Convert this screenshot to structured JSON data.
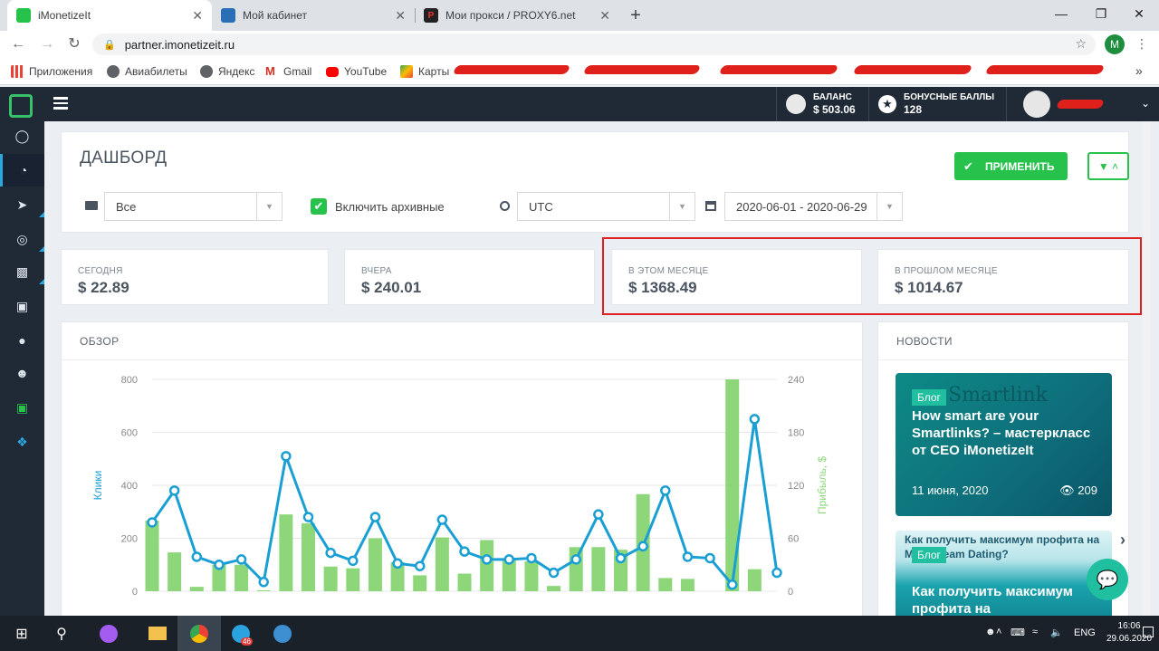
{
  "browser": {
    "tabs": [
      {
        "title": "iMonetizeIt",
        "color": "#27c24c"
      },
      {
        "title": "Мой кабинет",
        "color": "#2a6fb5"
      },
      {
        "title": "Мои прокси / PROXY6.net",
        "color": "#222222"
      }
    ],
    "new_tab": "+",
    "close": "✕",
    "url": "partner.imonetizeit.ru",
    "profile_initial": "M",
    "bookmarks": [
      {
        "label": "Приложения",
        "color": "#e94235"
      },
      {
        "label": "Авиабилеты",
        "color": "#5f6368"
      },
      {
        "label": "Яндекс",
        "color": "#5f6368"
      },
      {
        "label": "Gmail",
        "color": "#d93025"
      },
      {
        "label": "YouTube",
        "color": "#ff0000"
      },
      {
        "label": "Карты",
        "color": "#34a853"
      }
    ],
    "more": "»"
  },
  "topbar": {
    "balance_label": "БАЛАНС",
    "balance_value": "$ 503.06",
    "bonus_label": "БОНУСНЫЕ БАЛЛЫ",
    "bonus_value": "128"
  },
  "dashboard": {
    "title": "ДАШБОРД",
    "apply_label": "ПРИМЕНИТЬ",
    "filter_all": "Все",
    "include_archived": "Включить архивные",
    "timezone": "UTC",
    "date_range": "2020-06-01 - 2020-06-29"
  },
  "stats": [
    {
      "label": "СЕГОДНЯ",
      "value": "$ 22.89"
    },
    {
      "label": "ВЧЕРА",
      "value": "$ 240.01"
    },
    {
      "label": "В ЭТОМ МЕСЯЦЕ",
      "value": "$ 1368.49"
    },
    {
      "label": "В ПРОШЛОМ МЕСЯЦЕ",
      "value": "$ 1014.67"
    }
  ],
  "overview": {
    "title": "ОБЗОР"
  },
  "chart_data": {
    "type": "bar",
    "ylabel": "Клики",
    "y2label": "Прибыль, $",
    "ylim": [
      0,
      800
    ],
    "y2lim": [
      0,
      240
    ],
    "yticks": [
      0,
      200,
      400,
      600,
      800
    ],
    "y2ticks": [
      0,
      60,
      120,
      180,
      240
    ],
    "grid": true,
    "series": [
      {
        "name": "Прибыль, $",
        "type": "bar",
        "color": "#8dd77a",
        "axis": "right",
        "values": [
          80,
          44,
          5,
          30,
          30,
          1,
          87,
          77,
          28,
          26,
          60,
          33,
          18,
          61,
          20,
          58,
          37,
          34,
          6,
          50,
          50,
          47,
          110,
          15,
          14,
          0,
          240,
          25
        ]
      },
      {
        "name": "Клики",
        "type": "line",
        "color": "#1a9fd4",
        "axis": "left",
        "values": [
          260,
          380,
          130,
          100,
          120,
          35,
          510,
          280,
          145,
          115,
          280,
          105,
          95,
          270,
          150,
          120,
          120,
          125,
          70,
          120,
          290,
          125,
          170,
          380,
          130,
          125,
          25,
          650,
          70
        ]
      }
    ]
  },
  "news": {
    "title": "НОВОСТИ",
    "items": [
      {
        "tag": "Блог",
        "title": "How smart are your Smartlinks? – мастеркласс от CEO iMonetizeIt",
        "date": "11 июня, 2020",
        "views": "209",
        "bg": "Smartlink"
      },
      {
        "tag": "Блог",
        "title": "Как получить максимум профита на",
        "bg_text": "Как получить максимум профита на Mainstream Dating?"
      }
    ]
  },
  "taskbar": {
    "lang": "ENG",
    "time": "16:06",
    "date": "29.06.2020",
    "badge": "46"
  },
  "colors": {
    "accent_green": "#27c24c",
    "sidebar_bg": "#1f2a36",
    "highlight_red": "#e02020",
    "line_blue": "#1a9fd4",
    "bar_green": "#8dd77a"
  }
}
